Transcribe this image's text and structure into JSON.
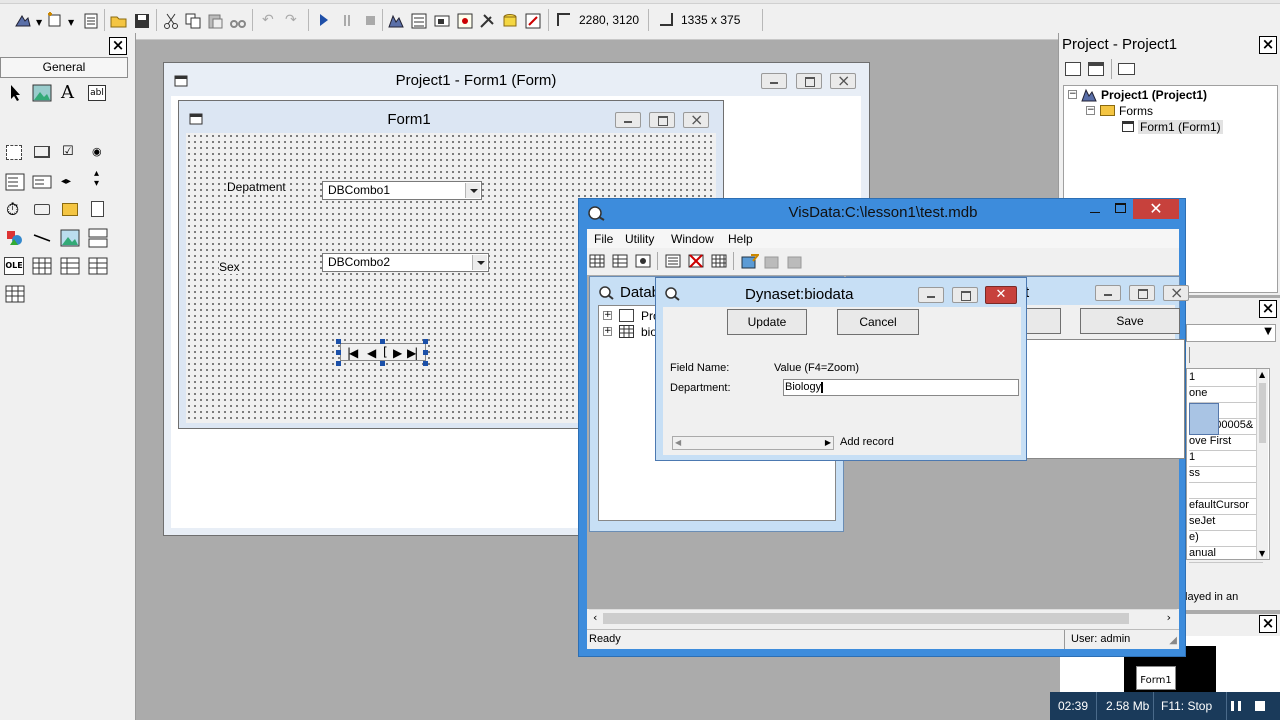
{
  "toolbar": {
    "position_readout": "2280, 3120",
    "size_readout": "1335 x 375"
  },
  "toolbox": {
    "title": "General",
    "tools": [
      "pointer",
      "picturebox",
      "label",
      "textbox",
      "frame",
      "commandbutton",
      "checkbox",
      "optionbutton",
      "combobox",
      "listbox",
      "hscrollbar",
      "vscrollbar",
      "timer",
      "drivelistbox",
      "dirlistbox",
      "filelistbox",
      "shape",
      "line",
      "image",
      "data",
      "ole",
      "dbgrid",
      "dbcombo",
      "dblist",
      "msflexgrid"
    ]
  },
  "designer": {
    "title": "Project1 - Form1 (Form)",
    "form": {
      "caption": "Form1",
      "label1": "Depatment",
      "combo1": "DBCombo1",
      "label2": "Sex",
      "combo2": "DBCombo2",
      "adodc_caption": "["
    }
  },
  "project": {
    "title": "Project - Project1",
    "root": "Project1 (Project1)",
    "folder": "Forms",
    "form": "Form1 (Form1)"
  },
  "properties": {
    "rows": [
      "1",
      "one",
      "",
      "H80000005&",
      "ove First",
      "1",
      "ss",
      "",
      "efaultCursor",
      "seJet",
      "e)",
      "anual"
    ],
    "desc": "layed in an"
  },
  "form_layout": {
    "form_label": "Form1"
  },
  "visdata": {
    "title": "VisData:C:\\lesson1\\test.mdb",
    "menu": [
      "File",
      "Utility",
      "Window",
      "Help"
    ],
    "db_window_title": "Datab",
    "db_tree": [
      "Pro",
      "biod"
    ],
    "sql_window_title": "t",
    "save_button": "Save",
    "status_left": "Ready",
    "status_right": "User: admin"
  },
  "dynaset": {
    "title": "Dynaset:biodata",
    "update_button": "Update",
    "cancel_button": "Cancel",
    "field_name_header": "Field Name:",
    "value_header": "Value (F4=Zoom)",
    "field_label": "Department:",
    "field_value": "Biology",
    "add_record": "Add record"
  },
  "statusbar": {
    "time": "02:39",
    "memory": "2.58 Mb",
    "stop": "F11: Stop"
  }
}
